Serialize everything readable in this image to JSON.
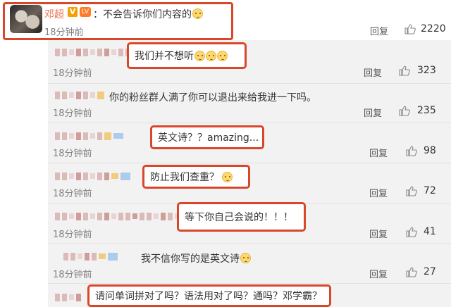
{
  "main_comment": {
    "username": "邓超",
    "verified_badge": "V",
    "level_badge": "LV",
    "text": "：不会告诉你们内容的",
    "time": "18分钟前",
    "reply_label": "回复",
    "likes": "2220",
    "emoji": "doge-emoji"
  },
  "replies": [
    {
      "text": "我们并不想听",
      "emoji_count": 3,
      "time": "18分钟前",
      "reply_label": "回复",
      "likes": "323",
      "highlighted": true
    },
    {
      "text": "你的粉丝群人满了你可以退出来给我进一下吗。",
      "emoji_count": 0,
      "time": "18分钟前",
      "reply_label": "回复",
      "likes": "235",
      "highlighted": false
    },
    {
      "text": "英文诗？？amazing...",
      "emoji_count": 0,
      "time": "18分钟前",
      "reply_label": "回复",
      "likes": "98",
      "highlighted": true
    },
    {
      "text": "防止我们查重？",
      "emoji_count": 1,
      "time": "18分钟前",
      "reply_label": "回复",
      "likes": "72",
      "highlighted": true
    },
    {
      "text": "等下你自己会说的！！！",
      "emoji_count": 0,
      "time": "18分钟前",
      "reply_label": "回复",
      "likes": "41",
      "highlighted": true
    },
    {
      "text": "我不信你写的是英文诗",
      "emoji_count": 1,
      "time": "18分钟前",
      "reply_label": "回复",
      "likes": "27",
      "highlighted": false
    },
    {
      "text": "请问单词拼对了吗？语法用对了吗？通吗？邓学霸？",
      "emoji_count": 0,
      "time": "",
      "reply_label": "",
      "likes": "",
      "highlighted": true
    }
  ],
  "colors": {
    "highlight_border": "#d9472b",
    "username": "#eb7350",
    "reply_bg": "#f2f2f2"
  },
  "icons": {
    "like": "thumbs-up-icon",
    "avatar": "avatar",
    "obscured_username": "pixelated-username"
  }
}
